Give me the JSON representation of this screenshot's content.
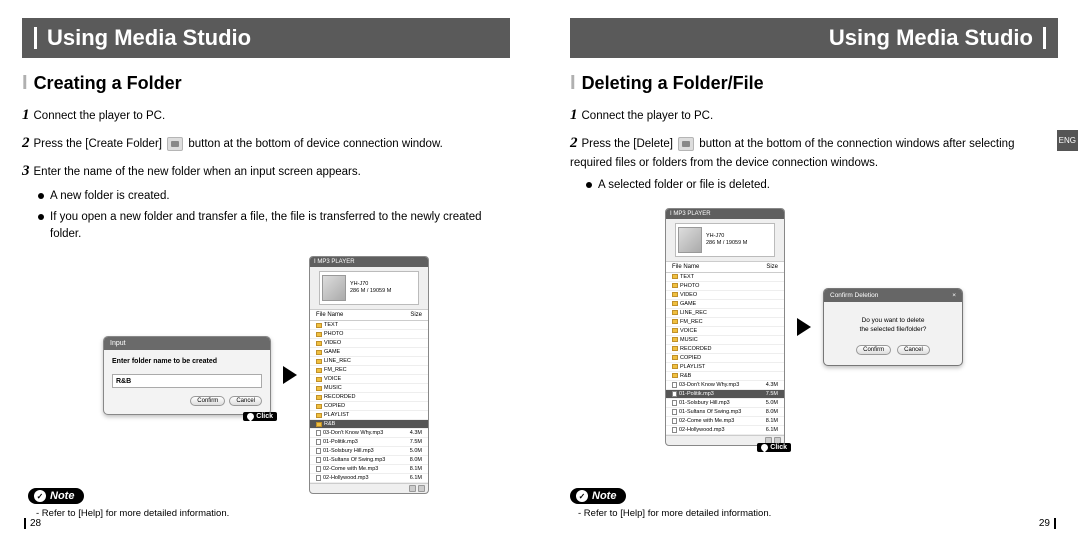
{
  "lang_tab": "ENG",
  "left": {
    "header": "Using Media Studio",
    "section_title": "Creating a Folder",
    "steps": {
      "s1": "Connect the player to PC.",
      "s2a": "Press the [Create Folder] ",
      "s2b": " button at the bottom of device connection window.",
      "s3": "Enter the name of the new folder when an input screen appears."
    },
    "bullets": {
      "b1": "A new folder is created.",
      "b2": "If you open a new folder and transfer a file, the file is transferred to the newly created folder."
    },
    "dlg": {
      "title": "Input",
      "label": "Enter folder name to be created",
      "value": "R&B",
      "confirm": "Confirm",
      "cancel": "Cancel"
    },
    "click": "Click",
    "panel": {
      "title": "I MP3 PLAYER",
      "device_name": "YH-J70",
      "device_size": "286 M / 19059 M",
      "col1": "File Name",
      "col2": "Size",
      "folders": [
        "TEXT",
        "PHOTO",
        "VIDEO",
        "GAME",
        "LINE_REC",
        "FM_REC",
        "VOICE",
        "MUSIC",
        "RECORDED",
        "COPIED",
        "PLAYLIST"
      ],
      "sel_folder": "R&B",
      "files": [
        {
          "n": "03-Don't Know Why.mp3",
          "s": "4.3M"
        },
        {
          "n": "01-Politik.mp3",
          "s": "7.5M"
        },
        {
          "n": "01-Solsbury Hill.mp3",
          "s": "5.0M"
        },
        {
          "n": "01-Sultans Of Swing.mp3",
          "s": "8.0M"
        },
        {
          "n": "02-Come with Me.mp3",
          "s": "8.1M"
        },
        {
          "n": "02-Hollywood.mp3",
          "s": "6.1M"
        }
      ]
    },
    "note_label": "Note",
    "note_text": "- Refer to [Help] for more detailed information.",
    "page_num": "28"
  },
  "right": {
    "header": "Using Media Studio",
    "section_title": "Deleting a Folder/File",
    "steps": {
      "s1": "Connect the player to PC.",
      "s2a": "Press the [Delete] ",
      "s2b": " button at the bottom of the connection windows after selecting required files or folders from the device connection windows."
    },
    "bullets": {
      "b1": "A selected folder or file is deleted."
    },
    "panel": {
      "title": "I MP3 PLAYER",
      "device_name": "YH-J70",
      "device_size": "286 M / 19059 M",
      "col1": "File Name",
      "col2": "Size",
      "folders": [
        "TEXT",
        "PHOTO",
        "VIDEO",
        "GAME",
        "LINE_REC",
        "FM_REC",
        "VOICE",
        "MUSIC",
        "RECORDED",
        "COPIED",
        "PLAYLIST",
        "R&B"
      ],
      "files": [
        {
          "n": "03-Don't Know Why.mp3",
          "s": "4.3M"
        },
        {
          "n": "01-Politik.mp3",
          "s": "7.5M",
          "sel": true
        },
        {
          "n": "01-Solsbury Hill.mp3",
          "s": "5.0M"
        },
        {
          "n": "01-Sultans Of Swing.mp3",
          "s": "8.0M"
        },
        {
          "n": "02-Come with Me.mp3",
          "s": "8.1M"
        },
        {
          "n": "02-Hollywood.mp3",
          "s": "6.1M"
        }
      ]
    },
    "click": "Click",
    "confirm": {
      "title": "Confirm Deletion",
      "line1": "Do you want to delete",
      "line2": "the selected file/folder?",
      "confirm": "Confirm",
      "cancel": "Cancel"
    },
    "note_label": "Note",
    "note_text": "- Refer to [Help] for more detailed information.",
    "page_num": "29"
  }
}
